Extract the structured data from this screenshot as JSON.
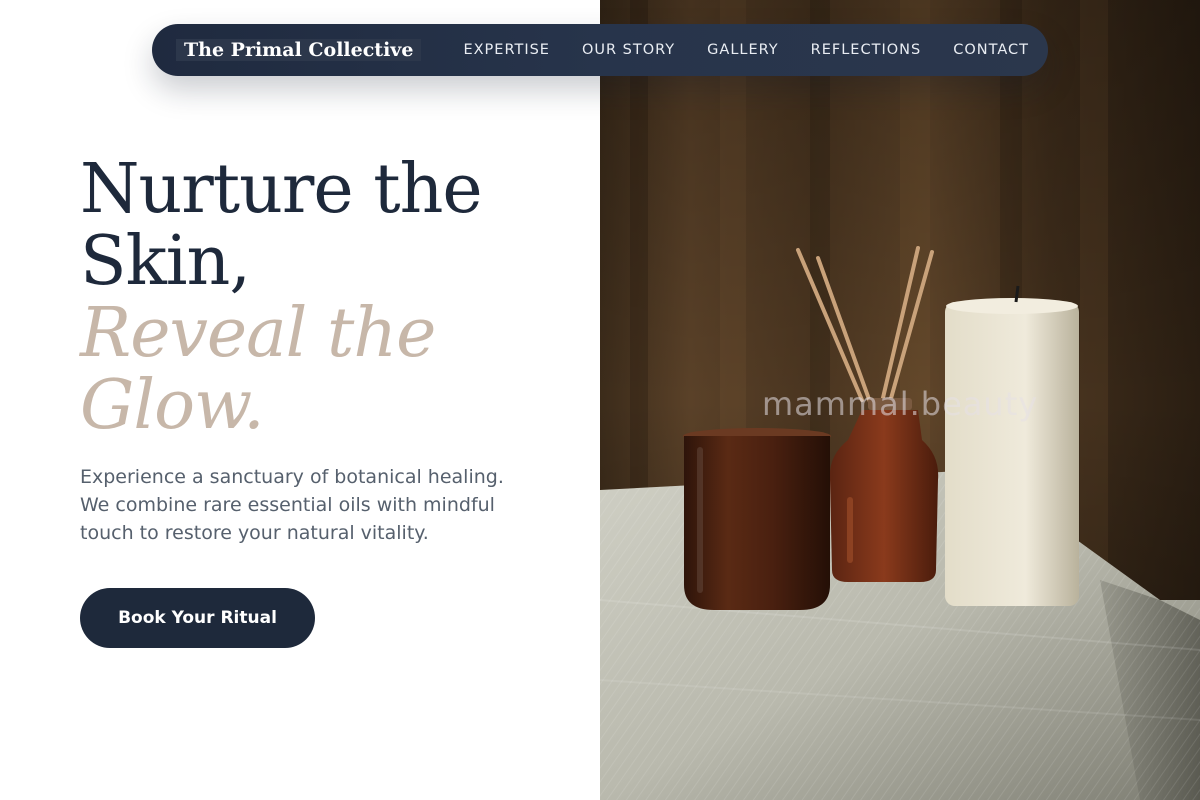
{
  "nav": {
    "brand": "The Primal Collective",
    "links": [
      "EXPERTISE",
      "OUR STORY",
      "GALLERY",
      "REFLECTIONS",
      "CONTACT"
    ]
  },
  "hero": {
    "headline_lines": [
      "Nurture the",
      "Skin,"
    ],
    "accent_lines": [
      "Reveal the",
      "Glow."
    ],
    "description_lines": [
      "Experience a sanctuary of botanical healing.",
      "We combine rare essential oils with mindful",
      "touch to restore your natural vitality."
    ],
    "cta_label": "Book Your Ritual",
    "image_watermark": "mammal.beauty"
  },
  "colors": {
    "navy": "#1e293b",
    "accent_tan": "#c7b7a9",
    "body_text": "#56606d"
  }
}
